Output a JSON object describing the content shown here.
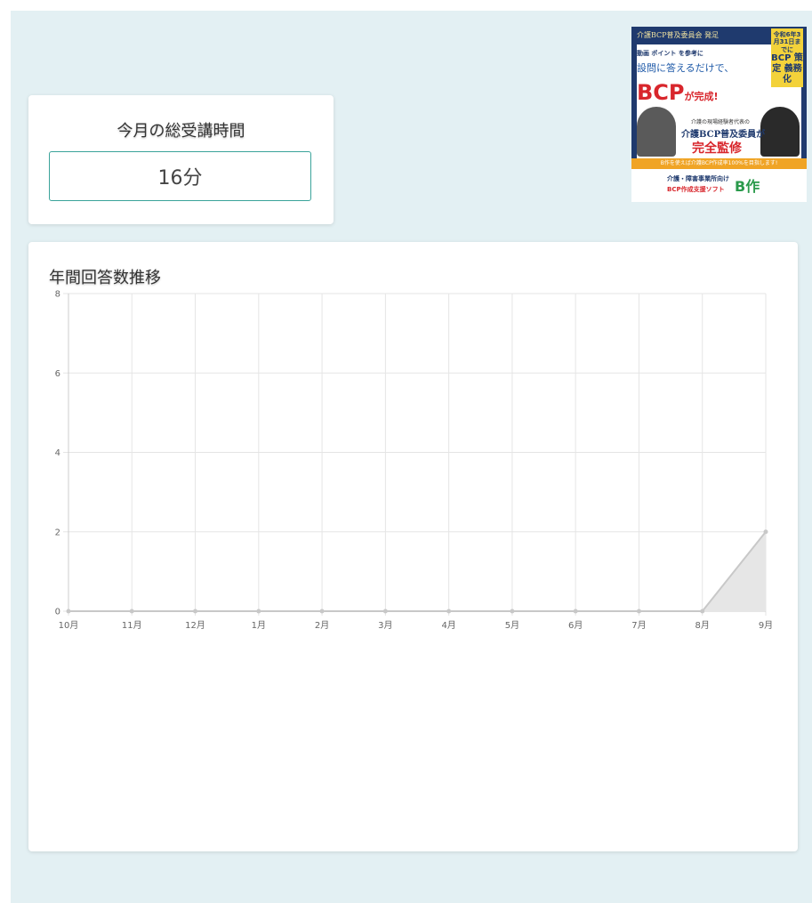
{
  "time_card": {
    "title": "今月の総受講時間",
    "value": "16分"
  },
  "ad": {
    "org": "介護BCP普及委員会 発足",
    "badge_small": "令和6年3月31日までに",
    "badge_big": "BCP 策定 義務化",
    "line1": "動画 ポイント を参考に",
    "line2": "設問に答えるだけで、",
    "line3_main": "BCP",
    "line3_suffix": "が完成!",
    "sub1": "介護の現場経験者代表の",
    "sub2": "介護BCP普及委員が",
    "sub3": "完全監修",
    "strip": "B作を使えば介護BCP作成率100%を目指します!",
    "bottom1": "介護・障害事業所向け",
    "bottom2": "BCP作成支援ソフト",
    "logo": "B作"
  },
  "chart_title": "年間回答数推移",
  "chart_data": {
    "type": "area",
    "title": "年間回答数推移",
    "categories": [
      "10月",
      "11月",
      "12月",
      "1月",
      "2月",
      "3月",
      "4月",
      "5月",
      "6月",
      "7月",
      "8月",
      "9月"
    ],
    "values": [
      0,
      0,
      0,
      0,
      0,
      0,
      0,
      0,
      0,
      0,
      0,
      2
    ],
    "ylim": [
      0,
      8
    ],
    "yticks": [
      0,
      2,
      4,
      6,
      8
    ],
    "grid": true,
    "colors": {
      "fill": "#e6e6e6",
      "line": "#c8c8c8",
      "point": "#c8c8c8",
      "grid": "#e5e5e5",
      "axis": "#cccccc"
    }
  }
}
